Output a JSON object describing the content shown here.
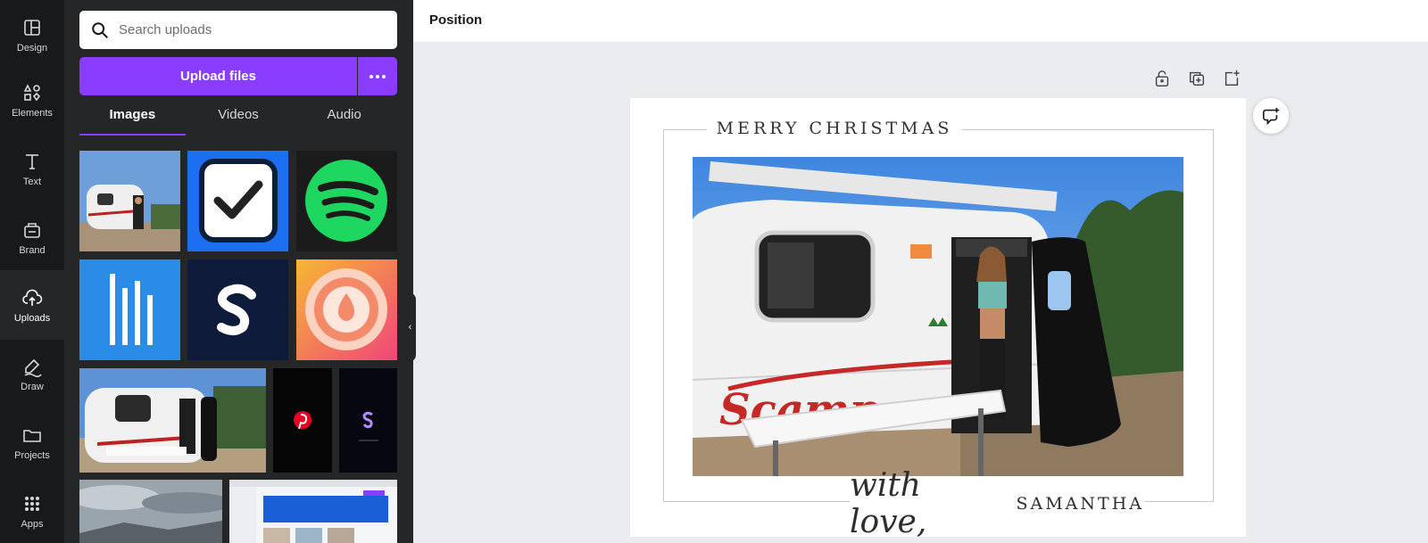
{
  "sidebar_rail": {
    "items": [
      {
        "label": "Design",
        "icon": "layout-icon"
      },
      {
        "label": "Elements",
        "icon": "shapes-icon"
      },
      {
        "label": "Text",
        "icon": "text-icon"
      },
      {
        "label": "Brand",
        "icon": "brand-icon"
      },
      {
        "label": "Uploads",
        "icon": "cloud-upload-icon",
        "active": true
      },
      {
        "label": "Draw",
        "icon": "pen-icon"
      },
      {
        "label": "Projects",
        "icon": "folder-icon"
      },
      {
        "label": "Apps",
        "icon": "grid-icon"
      }
    ]
  },
  "uploads_panel": {
    "search_placeholder": "Search uploads",
    "upload_button": "Upload files",
    "tabs": [
      {
        "label": "Images",
        "active": true
      },
      {
        "label": "Videos"
      },
      {
        "label": "Audio"
      }
    ],
    "thumbnails": [
      "camper-photo",
      "checkbox-app-logo",
      "spotify-logo",
      "striped-logo",
      "s-logo",
      "droplet-logo",
      "camper-photo-wide",
      "pinterest-video",
      "s-video",
      "sky-photo",
      "screenshot"
    ]
  },
  "topbar": {
    "title": "Position"
  },
  "canvas": {
    "page_tools": [
      "lock-icon",
      "duplicate-icon",
      "add-page-icon"
    ],
    "card": {
      "title": "MERRY CHRISTMAS",
      "signoff_script": "with love,",
      "signoff_name": "SAMANTHA"
    }
  },
  "colors": {
    "accent": "#8b3dff",
    "rail_bg": "#18191b",
    "panel_bg": "#252627",
    "canvas_bg": "#ebecf0"
  }
}
